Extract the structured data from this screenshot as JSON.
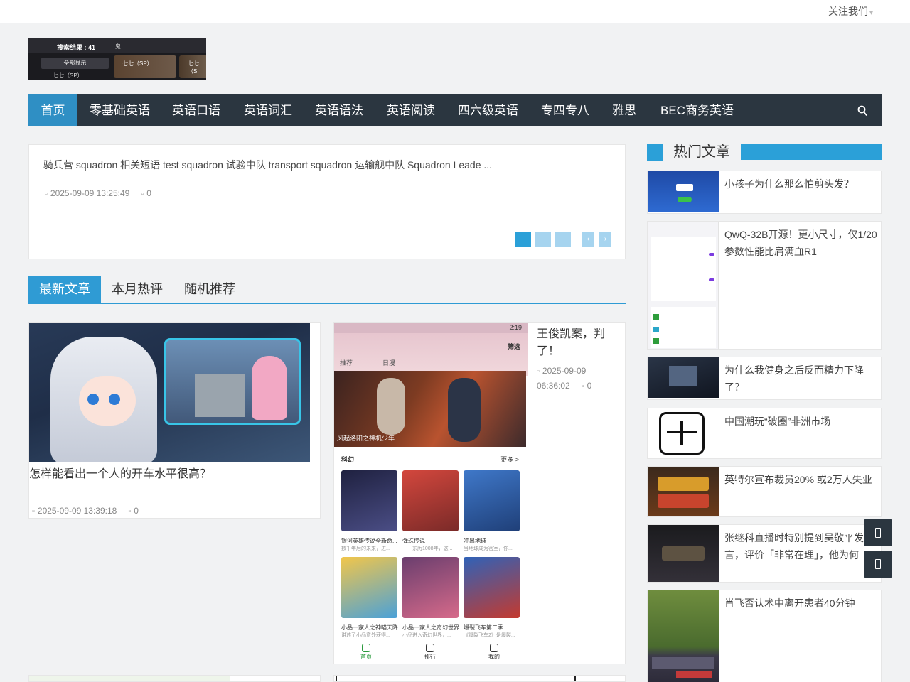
{
  "topbar": {
    "follow_label": "关注我们",
    "caret": "▾"
  },
  "logo": {
    "result_text": "搜索结果 : 41",
    "mark": "鬼",
    "all_label": "全部显示",
    "chip1": "七七（SP）",
    "chip2": "七七（S",
    "chip3": "七七（SP）"
  },
  "nav": {
    "items": [
      {
        "label": "首页",
        "active": true
      },
      {
        "label": "零基础英语"
      },
      {
        "label": "英语口语"
      },
      {
        "label": "英语词汇"
      },
      {
        "label": "英语语法"
      },
      {
        "label": "英语阅读"
      },
      {
        "label": "四六级英语"
      },
      {
        "label": "专四专八"
      },
      {
        "label": "雅思"
      },
      {
        "label": "BEC商务英语"
      }
    ],
    "search_icon": "search-icon"
  },
  "slider": {
    "excerpt": "骑兵营   squadron 相关短语   test squadron 试验中队 transport squadron 运输舰中队 Squadron Leade ...",
    "date": "2025-09-09 13:25:49",
    "comments": "0"
  },
  "tabs": [
    {
      "label": "最新文章",
      "active": true
    },
    {
      "label": "本月热评"
    },
    {
      "label": "随机推荐"
    }
  ],
  "cards": [
    {
      "title": "怎样能看出一个人的开车水平很高？",
      "date": "2025-09-09 13:39:18",
      "comments": "0"
    },
    {
      "title": "王俊凯案，判了！",
      "date_line1": "2025-09-09",
      "date_line2": "06:36:02",
      "comments": "0"
    }
  ],
  "phone": {
    "time": "2:19",
    "filter": "筛选",
    "tabs": [
      "推荐",
      "日漫"
    ],
    "banner_caption": "风起洛阳之神机少年",
    "section": "科幻",
    "more": "更多 >",
    "items": [
      {
        "name": "银河英雄传说全新命...",
        "desc": "数千年后的未来，进..."
      },
      {
        "name": "弹珠传说",
        "desc": "东历1008年，这..."
      },
      {
        "name": "冲出地球",
        "desc": "当地球成为密室，你..."
      },
      {
        "name": "小品一家人之神喵天降",
        "desc": "讲述了小品意外获得..."
      },
      {
        "name": "小品一家人之奇幻世界",
        "desc": "小品进入奇幻世界，..."
      },
      {
        "name": "爆裂飞车第二季",
        "desc": "《爆裂飞车2》是爆裂..."
      }
    ],
    "bottom_nav": [
      "首页",
      "排行",
      "我的"
    ]
  },
  "sidebar": {
    "heading": "热门文章",
    "items": [
      {
        "title": "小孩子为什么那么怕剪头发？"
      },
      {
        "title": "QwQ-32B开源！更小尺寸，仅1/20参数性能比肩满血R1"
      },
      {
        "title": "为什么我健身之后反而精力下降了？"
      },
      {
        "title": "中国潮玩“破圈”非洲市场"
      },
      {
        "title": "英特尔宣布裁员20% 或2万人失业"
      },
      {
        "title": "张继科直播时特别提到吴敬平发言，评价「非常在理」，他为何"
      },
      {
        "title": "肖飞否认术中离开患者40分钟"
      }
    ]
  },
  "colors": {
    "accent": "#2f9bd4",
    "nav_bg": "#2b3640"
  }
}
